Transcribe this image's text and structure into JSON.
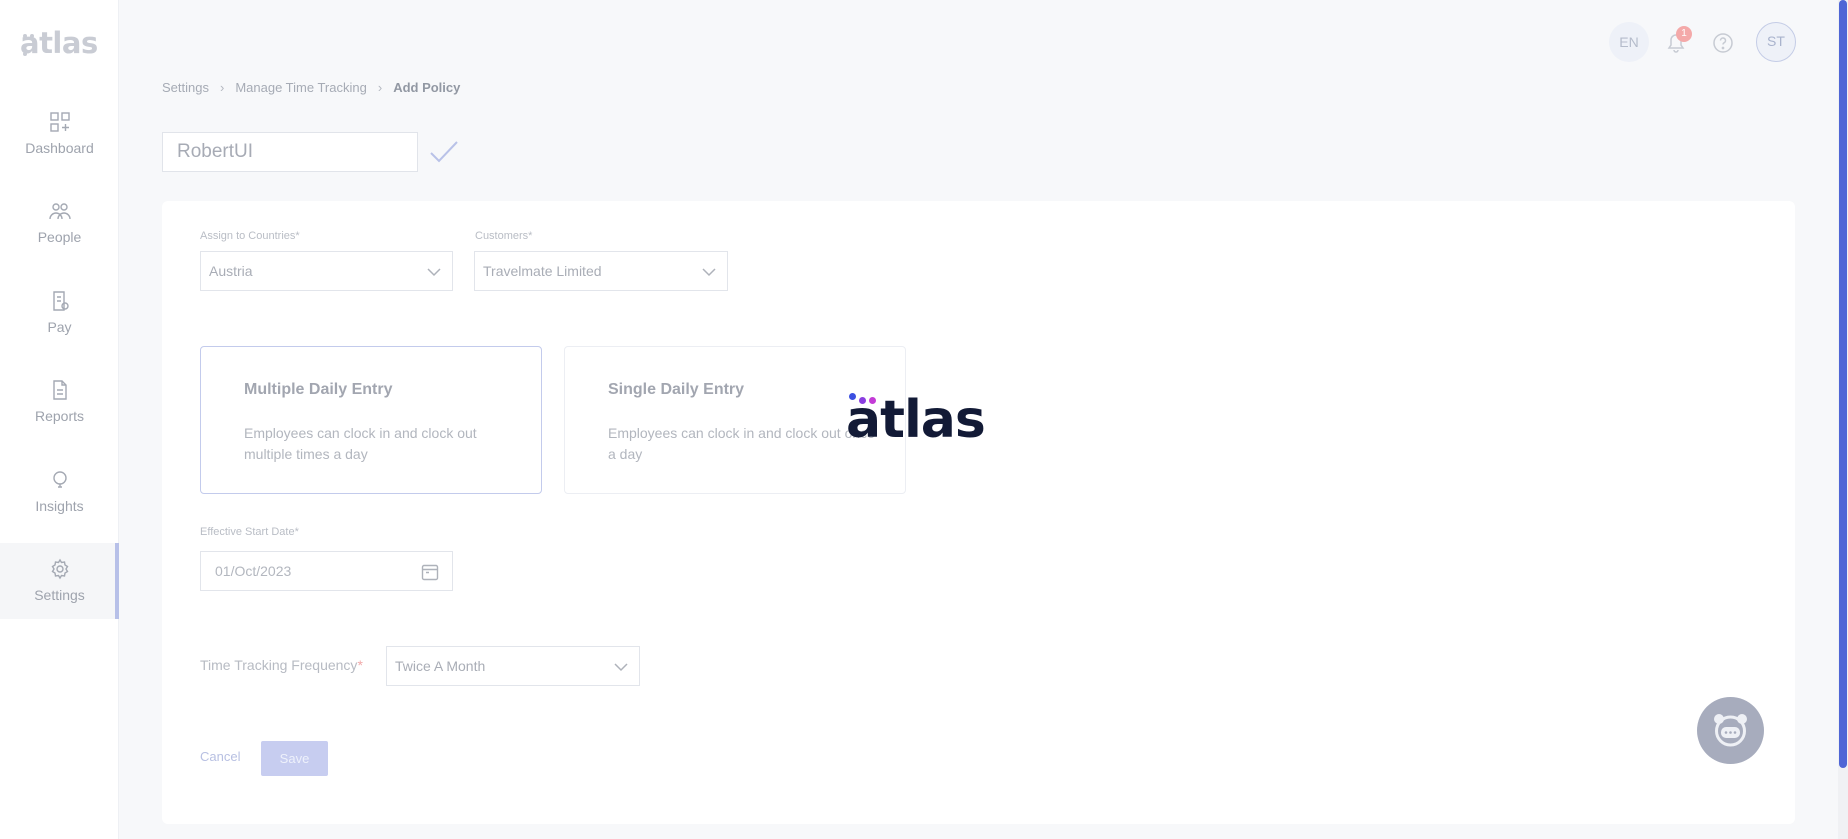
{
  "app": {
    "logo_text": "atlas"
  },
  "sidebar": {
    "items": [
      {
        "label": "Dashboard",
        "icon": "dashboard-icon"
      },
      {
        "label": "People",
        "icon": "people-icon"
      },
      {
        "label": "Pay",
        "icon": "pay-icon"
      },
      {
        "label": "Reports",
        "icon": "reports-icon"
      },
      {
        "label": "Insights",
        "icon": "insights-icon"
      },
      {
        "label": "Settings",
        "icon": "gear-icon",
        "active": true
      }
    ]
  },
  "header": {
    "language": "EN",
    "notification_count": "1",
    "avatar_initials": "ST"
  },
  "breadcrumb": {
    "items": [
      "Settings",
      "Manage Time Tracking"
    ],
    "current": "Add Policy"
  },
  "policy": {
    "name": "RobertUI"
  },
  "form": {
    "countries": {
      "label": "Assign to Countries*",
      "value": "Austria"
    },
    "customers": {
      "label": "Customers*",
      "value": "Travelmate Limited"
    },
    "entry_types": [
      {
        "title": "Multiple Daily Entry",
        "description": "Employees can clock in and clock out multiple times a day",
        "selected": true
      },
      {
        "title": "Single Daily Entry",
        "description": "Employees can clock in and clock out once a day",
        "selected": false
      }
    ],
    "start_date": {
      "label": "Effective Start Date*",
      "value": "01/Oct/2023"
    },
    "frequency": {
      "label": "Time Tracking Frequency",
      "required_mark": "*",
      "value": "Twice A Month"
    },
    "cancel_label": "Cancel",
    "save_label": "Save"
  },
  "loader": {
    "text": "atlas",
    "dot_colors": [
      "#3b4fe0",
      "#8a3ee0",
      "#c33bd6"
    ]
  },
  "colors": {
    "accent": "#4f66d6",
    "selected_border": "#c3cbec",
    "brand_dark": "#121a36"
  }
}
